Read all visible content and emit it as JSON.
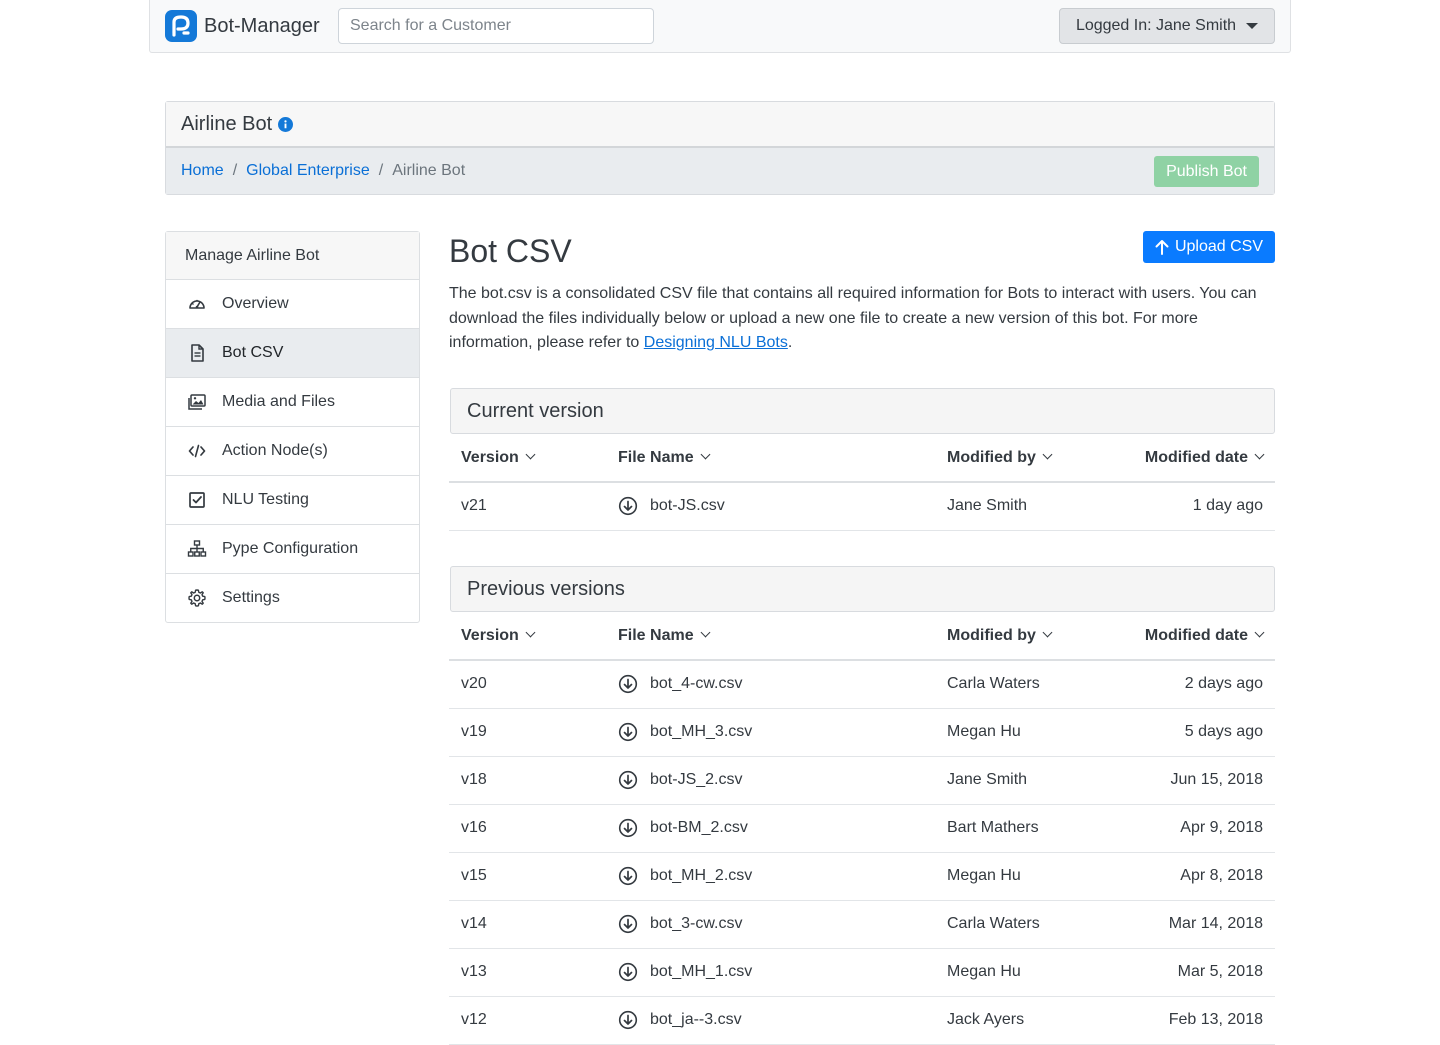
{
  "navbar": {
    "brand": "Bot-Manager",
    "search_placeholder": "Search for a Customer",
    "user_label": "Logged In: Jane Smith"
  },
  "bot": {
    "title": "Airline Bot",
    "breadcrumb": [
      {
        "label": "Home"
      },
      {
        "label": "Global Enterprise"
      },
      {
        "label": "Airline Bot"
      }
    ],
    "publish_label": "Publish Bot"
  },
  "sidebar": {
    "heading": "Manage Airline Bot",
    "items": [
      {
        "label": "Overview",
        "icon": "dashboard-icon"
      },
      {
        "label": "Bot CSV",
        "icon": "document-icon"
      },
      {
        "label": "Media and Files",
        "icon": "images-icon"
      },
      {
        "label": "Action Node(s)",
        "icon": "code-icon"
      },
      {
        "label": "NLU Testing",
        "icon": "checkbox-icon"
      },
      {
        "label": "Pype Configuration",
        "icon": "sitemap-icon"
      },
      {
        "label": "Settings",
        "icon": "gear-icon"
      }
    ],
    "active_index": 1
  },
  "main": {
    "title": "Bot CSV",
    "upload_label": "Upload CSV",
    "description_pre": "The bot.csv is a consolidated CSV file that contains all required information for Bots to interact with users. You can download the files individually below or upload a new one file to create a new version of this bot. For more information, please refer to ",
    "description_link": "Designing NLU Bots",
    "description_post": ".",
    "columns": [
      "Version",
      "File Name",
      "Modified by",
      "Modified date"
    ],
    "current": {
      "heading": "Current version",
      "rows": [
        {
          "version": "v21",
          "file": "bot-JS.csv",
          "modified_by": "Jane Smith",
          "modified_date": "1 day ago"
        }
      ]
    },
    "previous": {
      "heading": "Previous versions",
      "rows": [
        {
          "version": "v20",
          "file": "bot_4-cw.csv",
          "modified_by": "Carla Waters",
          "modified_date": "2 days ago"
        },
        {
          "version": "v19",
          "file": "bot_MH_3.csv",
          "modified_by": "Megan Hu",
          "modified_date": "5 days ago"
        },
        {
          "version": "v18",
          "file": "bot-JS_2.csv",
          "modified_by": "Jane Smith",
          "modified_date": "Jun 15, 2018"
        },
        {
          "version": "v16",
          "file": "bot-BM_2.csv",
          "modified_by": "Bart Mathers",
          "modified_date": "Apr 9, 2018"
        },
        {
          "version": "v15",
          "file": "bot_MH_2.csv",
          "modified_by": "Megan Hu",
          "modified_date": "Apr 8, 2018"
        },
        {
          "version": "v14",
          "file": "bot_3-cw.csv",
          "modified_by": "Carla Waters",
          "modified_date": "Mar 14, 2018"
        },
        {
          "version": "v13",
          "file": "bot_MH_1.csv",
          "modified_by": "Megan Hu",
          "modified_date": "Mar 5, 2018"
        },
        {
          "version": "v12",
          "file": "bot_ja--3.csv",
          "modified_by": "Jack Ayers",
          "modified_date": "Feb 13, 2018"
        }
      ]
    }
  },
  "colors": {
    "primary": "#0a7bff",
    "link": "#0a6fd6",
    "publish_disabled": "#8fd2a4",
    "active_item_bg": "#e9ecef"
  }
}
